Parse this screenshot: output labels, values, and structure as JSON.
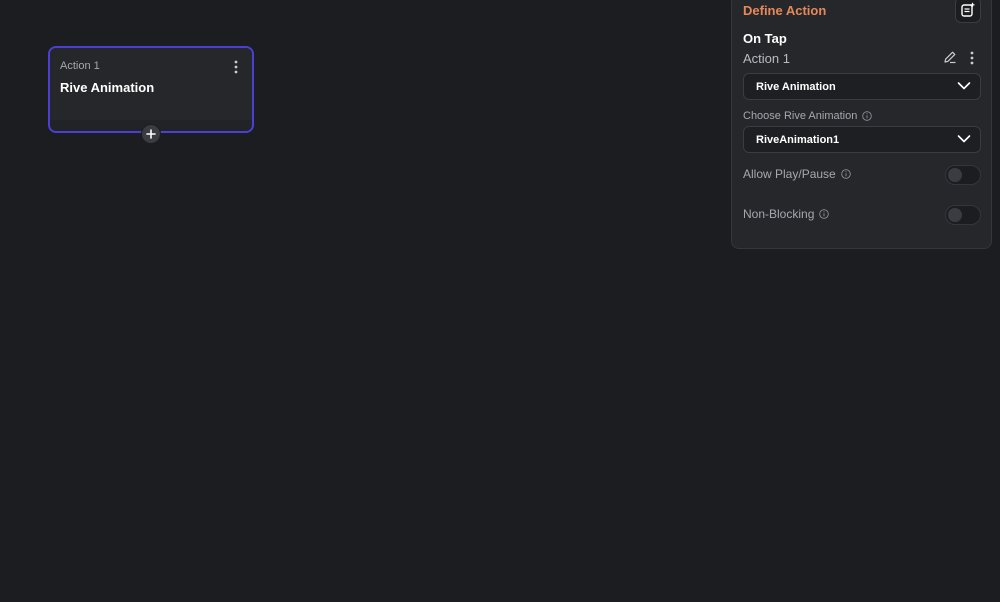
{
  "action_node": {
    "subtitle": "Action 1",
    "title": "Rive Animation",
    "menu_icon": "more-vertical-icon",
    "add_icon": "plus-icon"
  },
  "panel": {
    "title": "Define Action",
    "title_color": "#e6885a",
    "add_note_icon": "note-add-icon",
    "trigger": "On Tap",
    "action_name": "Action 1",
    "action_type_select": {
      "value": "Rive Animation"
    },
    "choose_animation": {
      "label": "Choose Rive Animation",
      "value": "RiveAnimation1"
    },
    "allow_play_pause": {
      "label": "Allow Play/Pause",
      "enabled": false
    },
    "non_blocking": {
      "label": "Non-Blocking",
      "enabled": false
    }
  },
  "colors": {
    "background": "#1c1d21",
    "selected_border": "#4b3fd6",
    "accent": "#e6885a"
  }
}
